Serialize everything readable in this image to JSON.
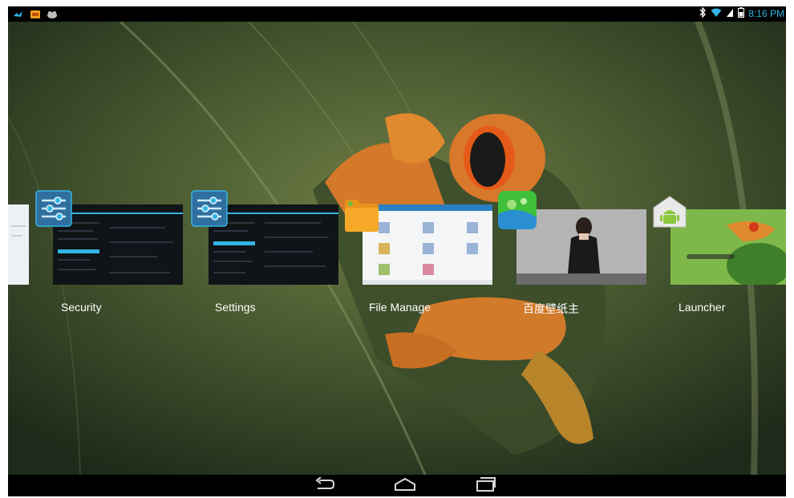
{
  "status_bar": {
    "time": "8:16 PM",
    "left_icons": [
      "bird-notification-icon",
      "app-notification-icon",
      "cat-notification-icon"
    ],
    "right_icons": [
      "bluetooth-icon",
      "wifi-icon",
      "signal-icon",
      "battery-icon"
    ]
  },
  "recent_apps": [
    {
      "label": "Security"
    },
    {
      "label": "Settings"
    },
    {
      "label": "File Manage"
    },
    {
      "label": "百度壁纸主"
    },
    {
      "label": "Launcher"
    }
  ],
  "nav_bar": {
    "buttons": [
      "back",
      "home",
      "recents"
    ]
  },
  "colors": {
    "accent": "#33b5e5",
    "bar": "#000000"
  }
}
